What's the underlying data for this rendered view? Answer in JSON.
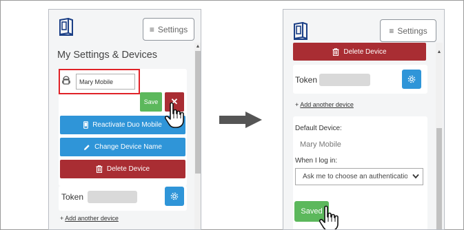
{
  "left": {
    "settings_label": "Settings",
    "heading": "My Settings & Devices",
    "device_name_value": "Mary Mobile",
    "save_label": "Save",
    "close_glyph": "✕",
    "reactivate_label": "Reactivate Duo Mobile",
    "change_name_label": "Change Device Name",
    "delete_label": "Delete Device",
    "token_label": "Token",
    "add_device_plus": "+",
    "add_device_label": "Add another device"
  },
  "right": {
    "settings_label": "Settings",
    "delete_label": "Delete Device",
    "token_label": "Token",
    "add_device_plus": "+",
    "add_device_label": "Add another device",
    "default_device_label": "Default Device:",
    "default_device_value": "Mary Mobile",
    "when_login_label": "When I log in:",
    "login_option": "Ask me to choose an authentication method",
    "saved_label": "Saved"
  },
  "colors": {
    "blue": "#2f95d8",
    "red": "#a92d33",
    "green": "#5cb85c",
    "highlight": "#e02127",
    "arrow": "#555555"
  },
  "icons": [
    "duo-logo-icon",
    "hamburger-icon",
    "android-icon",
    "close-icon",
    "phone-icon",
    "pencil-icon",
    "trash-icon",
    "gear-icon",
    "pointer-hand-icon",
    "chevron-down-icon",
    "right-arrow-icon"
  ]
}
